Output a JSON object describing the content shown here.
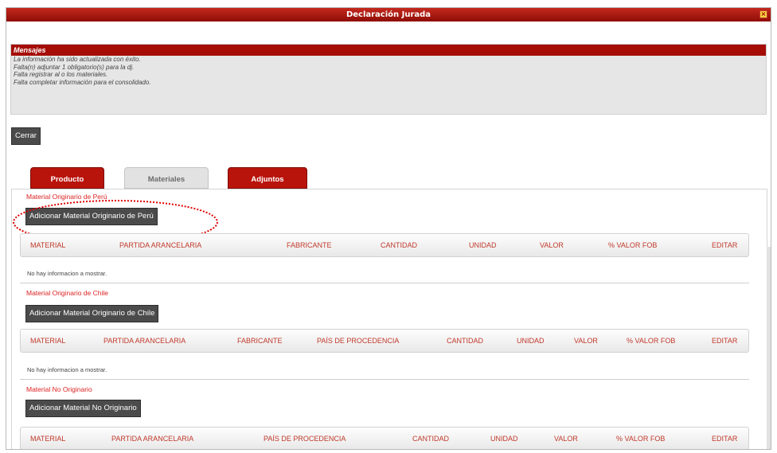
{
  "window": {
    "title": "Declaración Jurada"
  },
  "messages": {
    "header": "Mensajes",
    "lines": [
      "La información ha sido actualizada con éxito.",
      "Falta(n) adjuntar 1 obligatorio(s) para la dj.",
      "Falta registrar al o los materiales.",
      "Falta completar información para el consolidado."
    ]
  },
  "buttons": {
    "close": "Cerrar"
  },
  "tabs": [
    {
      "label": "Producto",
      "active": false
    },
    {
      "label": "Materiales",
      "active": true
    },
    {
      "label": "Adjuntos",
      "active": false
    }
  ],
  "sections": [
    {
      "title": "Material Originario de Perú",
      "add_button": "Adicionar Material Originario de Perú",
      "columns": [
        "MATERIAL",
        "PARTIDA ARANCELARIA",
        "FABRICANTE",
        "CANTIDAD",
        "UNIDAD",
        "VALOR",
        "% VALOR FOB",
        "EDITAR"
      ],
      "empty": "No hay informacion a mostrar."
    },
    {
      "title": "Material Originario de Chile",
      "add_button": "Adicionar Material Originario de Chile",
      "columns": [
        "MATERIAL",
        "PARTIDA ARANCELARIA",
        "FABRICANTE",
        "PAÍS DE PROCEDENCIA",
        "CANTIDAD",
        "UNIDAD",
        "VALOR",
        "% VALOR FOB",
        "EDITAR"
      ],
      "empty": "No hay informacion a mostrar."
    },
    {
      "title": "Material No Originario",
      "add_button": "Adicionar Material No Originario",
      "columns": [
        "MATERIAL",
        "PARTIDA ARANCELARIA",
        "PAÍS DE PROCEDENCIA",
        "CANTIDAD",
        "UNIDAD",
        "VALOR",
        "% VALOR FOB",
        "EDITAR"
      ]
    }
  ],
  "colors": {
    "brand_red": "#a50e07",
    "header_text": "#c0392b",
    "button_dark": "#4b4b4b",
    "highlight": "#e00000"
  }
}
